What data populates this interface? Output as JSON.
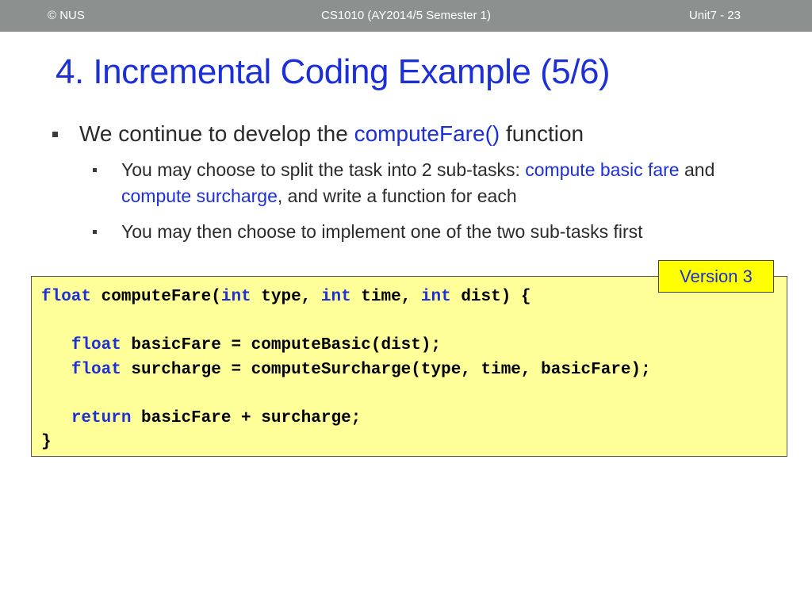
{
  "header": {
    "left": "© NUS",
    "center": "CS1010 (AY2014/5 Semester 1)",
    "right": "Unit7 - 23"
  },
  "title": "4. Incremental Coding Example (5/6)",
  "bullets": {
    "main": {
      "prefix": "We continue to develop the ",
      "highlight": "computeFare()",
      "suffix": " function"
    },
    "sub1": {
      "part1": "You may choose to split the task into 2 sub-tasks: ",
      "highlight1": "compute basic fare",
      "part2": " and ",
      "highlight2": "compute surcharge",
      "part3": ", and write a function for each"
    },
    "sub2": {
      "text": "You may then choose to implement one of the two sub-tasks first"
    }
  },
  "code": {
    "line1": {
      "kw1": "float",
      "t1": " computeFare(",
      "kw2": "int",
      "t2": " type, ",
      "kw3": "int",
      "t3": " time, ",
      "kw4": "int",
      "t4": " dist) {"
    },
    "line3": {
      "indent": "   ",
      "kw": "float",
      "rest": " basicFare = computeBasic(dist);"
    },
    "line4": {
      "indent": "   ",
      "kw": "float",
      "rest": " surcharge = computeSurcharge(type, time, basicFare);"
    },
    "line6": {
      "indent": "   ",
      "kw": "return",
      "rest": " basicFare + surcharge;"
    },
    "line7": "}"
  },
  "version_label": "Version 3",
  "colors": {
    "accent": "#1d2fd6",
    "header_bg": "#8c918f",
    "code_bg": "#ffff99",
    "label_bg": "#ffff00"
  }
}
